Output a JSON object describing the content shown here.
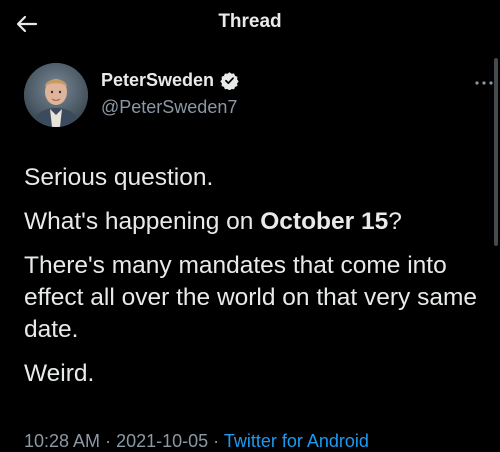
{
  "header": {
    "title": "Thread",
    "back_icon": "arrow-left-icon"
  },
  "author": {
    "display_name": "PeterSweden",
    "handle": "@PeterSweden7",
    "verified_icon": "verified-badge-icon",
    "more_icon": "more-options-icon"
  },
  "tweet": {
    "line1": "Serious question.",
    "line2_prefix": "What's happening on ",
    "line2_bold": "October 15",
    "line2_suffix": "?",
    "line3": "There's many mandates that come into effect all over the world on that very same date.",
    "line4": "Weird."
  },
  "meta": {
    "time": "10:28 AM",
    "separator1": " · ",
    "date": "2021-10-05",
    "separator2": " · ",
    "source": "Twitter for Android"
  },
  "colors": {
    "background": "#000000",
    "text": "#e7e9ea",
    "secondary": "#8b98a5",
    "link": "#1d9bf0"
  }
}
